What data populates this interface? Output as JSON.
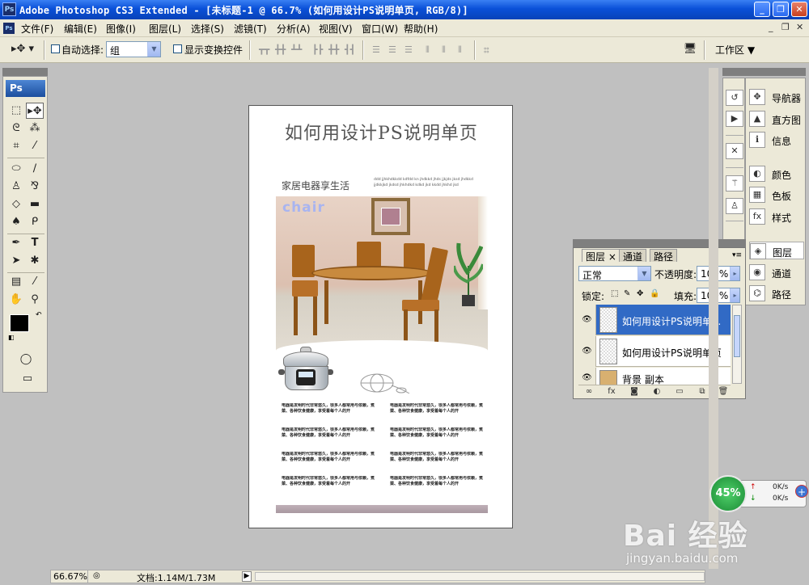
{
  "window": {
    "title": "Adobe Photoshop CS3 Extended - [未标题-1 @ 66.7% (如何用设计PS说明单页, RGB/8)]",
    "app_icon": "Ps",
    "controls": [
      "_",
      "❐",
      "✕"
    ]
  },
  "menu": {
    "items": [
      "文件(F)",
      "编辑(E)",
      "图像(I)",
      "图层(L)",
      "选择(S)",
      "滤镜(T)",
      "分析(A)",
      "视图(V)",
      "窗口(W)",
      "帮助(H)"
    ],
    "mdi_controls": [
      "_",
      "❐",
      "✕"
    ]
  },
  "options": {
    "auto_select_label": "自动选择:",
    "auto_select_value": "组",
    "show_transform_label": "显示变换控件",
    "workspace_label": "工作区 ▼"
  },
  "toolbox": {
    "logo": "Ps",
    "tools": [
      "marquee-icon",
      "move-icon",
      "lasso-icon",
      "magic-wand-icon",
      "crop-icon",
      "eyedropper-small-icon",
      "healing-icon",
      "brush-icon",
      "stamp-icon",
      "history-brush-icon",
      "eraser-icon",
      "gradient-icon",
      "blur-icon",
      "dodge-icon",
      "pen-icon",
      "type-icon",
      "path-select-icon",
      "shape-icon",
      "notes-icon",
      "eyedropper-icon",
      "hand-icon",
      "zoom-icon"
    ],
    "foreground_color": "#000000",
    "background_color": "#ffffff"
  },
  "document": {
    "headline": "如何用设计PS说明单页",
    "subhead": "家居电器享生活",
    "small_text": "ddd jjhkhdkkdd kdfdd kn jhdkkd jhds jjkjds jksd jhdkkd jjdkkjkd jkdsd jhkhdkd kdkd jkd kkdd jhkhd jkd",
    "photo_word": "chair",
    "body_paragraph": "电器是发明时代非常悠久，很多人都常用与依赖，煮菜、各种饮食健康，享受着每个人的开",
    "paragraph_count": 8
  },
  "dock": {
    "items": [
      {
        "label": "导航器",
        "icon": "navigator-icon"
      },
      {
        "label": "直方图",
        "icon": "histogram-icon"
      },
      {
        "label": "信息",
        "icon": "info-icon"
      },
      {
        "label": "颜色",
        "icon": "color-icon"
      },
      {
        "label": "色板",
        "icon": "swatches-icon"
      },
      {
        "label": "样式",
        "icon": "styles-icon"
      },
      {
        "label": "图层",
        "icon": "layers-icon"
      },
      {
        "label": "通道",
        "icon": "channels-icon"
      },
      {
        "label": "路径",
        "icon": "paths-icon"
      }
    ]
  },
  "layers_panel": {
    "tabs": [
      "图层 ×",
      "通道",
      "路径"
    ],
    "blend_mode": "正常",
    "opacity_label": "不透明度:",
    "opacity_value": "100%",
    "lock_label": "锁定:",
    "fill_label": "填充:",
    "fill_value": "100%",
    "layers": [
      {
        "name": "如何用设计PS说明单...",
        "selected": true
      },
      {
        "name": "如何用设计PS说明单页",
        "selected": false
      },
      {
        "name": "背景 副本",
        "selected": false
      }
    ]
  },
  "status": {
    "zoom": "66.67%",
    "doc_info": "文档:1.14M/1.73M"
  },
  "network": {
    "percent": "45%",
    "up_rate": "0K/s",
    "down_rate": "0K/s"
  },
  "watermark": {
    "logo": "Bai 经验",
    "url": "jingyan.baidu.com"
  }
}
